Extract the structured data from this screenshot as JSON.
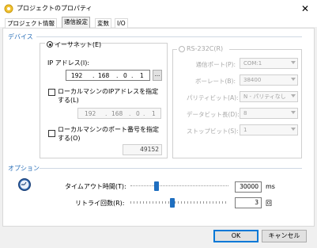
{
  "window": {
    "title": "プロジェクトのプロパティ",
    "close_glyph": "✕"
  },
  "tabs": [
    {
      "label": "プロジェクト情報",
      "active": false
    },
    {
      "label": "通信設定",
      "active": true
    },
    {
      "label": "変数",
      "active": false
    },
    {
      "label": "I/O",
      "active": false
    }
  ],
  "device": {
    "section_label": "デバイス",
    "ethernet": {
      "radio_label": "イーサネット(E)",
      "selected": true,
      "ip_label": "IP アドレス(I):",
      "ip": [
        "192",
        "168",
        "0",
        "1"
      ],
      "browse_label": "...",
      "local_ip_check_label_line1": "ローカルマシンのIPアドレスを指定",
      "local_ip_check_label_line2": "する(L)",
      "local_ip_checked": false,
      "local_ip": [
        "192",
        "168",
        "0",
        "1"
      ],
      "local_port_check_label_line1": "ローカルマシンのポート番号を指定",
      "local_port_check_label_line2": "する(O)",
      "local_port_checked": false,
      "local_port": "49152"
    },
    "serial": {
      "radio_label": "RS-232C(R)",
      "selected": false,
      "fields": [
        {
          "label": "通信ポート(P):",
          "value": "COM:1"
        },
        {
          "label": "ボーレート(B):",
          "value": "38400"
        },
        {
          "label": "パリティビット(A):",
          "value": "N - パリティなし"
        },
        {
          "label": "データビット長(D):",
          "value": "8"
        },
        {
          "label": "ストップビット(S):",
          "value": "1"
        }
      ]
    }
  },
  "options": {
    "section_label": "オプション",
    "timeout": {
      "label": "タイムアウト時間(T):",
      "value": "30000",
      "unit": "ms",
      "slider_fraction": 0.25
    },
    "retry": {
      "label": "リトライ回数(R):",
      "value": "3",
      "unit": "回",
      "slider_fraction": 0.42
    }
  },
  "buttons": {
    "ok": "OK",
    "cancel": "キャンセル"
  },
  "colors": {
    "accent": "#2a6fb8",
    "slider_thumb": "#1f6fc0"
  }
}
